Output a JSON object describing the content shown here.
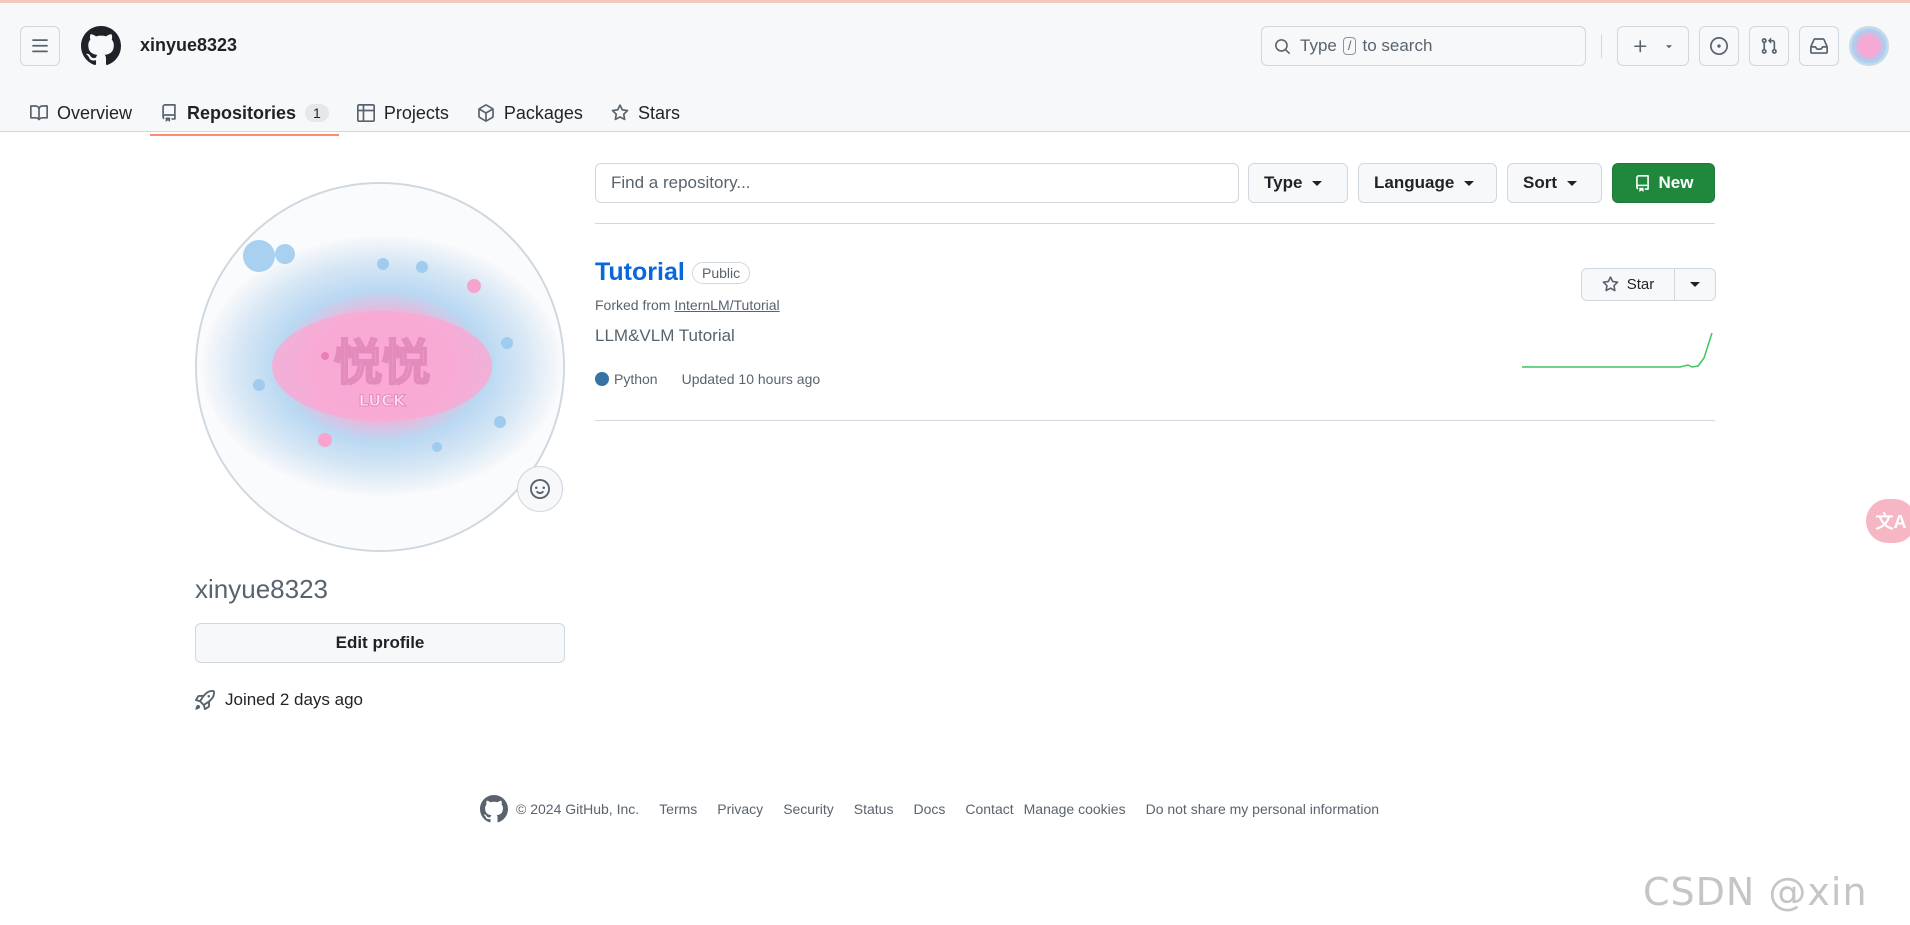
{
  "header": {
    "username": "xinyue8323",
    "search_pre": "Type",
    "search_key": "/",
    "search_post": "to search"
  },
  "tabs": [
    {
      "label": "Overview",
      "icon": "book-icon",
      "active": false
    },
    {
      "label": "Repositories",
      "icon": "repo-icon",
      "active": true,
      "count": "1"
    },
    {
      "label": "Projects",
      "icon": "table-icon",
      "active": false
    },
    {
      "label": "Packages",
      "icon": "package-icon",
      "active": false
    },
    {
      "label": "Stars",
      "icon": "star-icon",
      "active": false
    }
  ],
  "profile": {
    "name": "xinyue8323",
    "edit_label": "Edit profile",
    "joined": "Joined 2 days ago"
  },
  "filters": {
    "find_placeholder": "Find a repository...",
    "type_label": "Type",
    "language_label": "Language",
    "sort_label": "Sort",
    "new_label": "New"
  },
  "repo": {
    "name": "Tutorial",
    "visibility": "Public",
    "forked_prefix": "Forked from",
    "forked_source": "InternLM/Tutorial",
    "description": "LLM&VLM Tutorial",
    "language": "Python",
    "language_color": "#3572A5",
    "updated": "Updated 10 hours ago",
    "star_label": "Star"
  },
  "footer": {
    "copyright": "© 2024 GitHub, Inc.",
    "links": [
      "Terms",
      "Privacy",
      "Security",
      "Status",
      "Docs",
      "Contact",
      "Manage cookies",
      "Do not share my personal information"
    ]
  },
  "overlay": {
    "translate_label": "文A",
    "watermark": "CSDN @xin yue."
  },
  "colors": {
    "accent_green": "#1f883d",
    "link_blue": "#0969da",
    "tab_underline": "#fd8c73"
  }
}
